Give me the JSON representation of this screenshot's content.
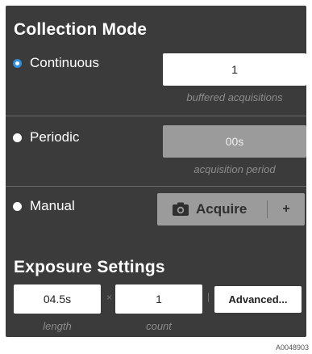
{
  "collection": {
    "title": "Collection Mode",
    "continuous": {
      "label": "Continuous",
      "value": "1",
      "caption": "buffered acquisitions",
      "selected": true
    },
    "periodic": {
      "label": "Periodic",
      "value": "00s",
      "caption": "acquisition period",
      "selected": false
    },
    "manual": {
      "label": "Manual",
      "acquire_label": "Acquire",
      "plus_label": "+",
      "selected": false
    }
  },
  "exposure": {
    "title": "Exposure Settings",
    "length_value": "04.5s",
    "length_caption": "length",
    "times_symbol": "×",
    "count_value": "1",
    "count_caption": "count",
    "divider_symbol": "|",
    "advanced_label": "Advanced..."
  },
  "footnote": "A0048903",
  "colors": {
    "panel_bg": "#3b3b3b",
    "accent_radio": "#2d8fe0",
    "disabled_field": "#9b9b9b"
  },
  "icons": {
    "acquire": "camera-icon"
  }
}
